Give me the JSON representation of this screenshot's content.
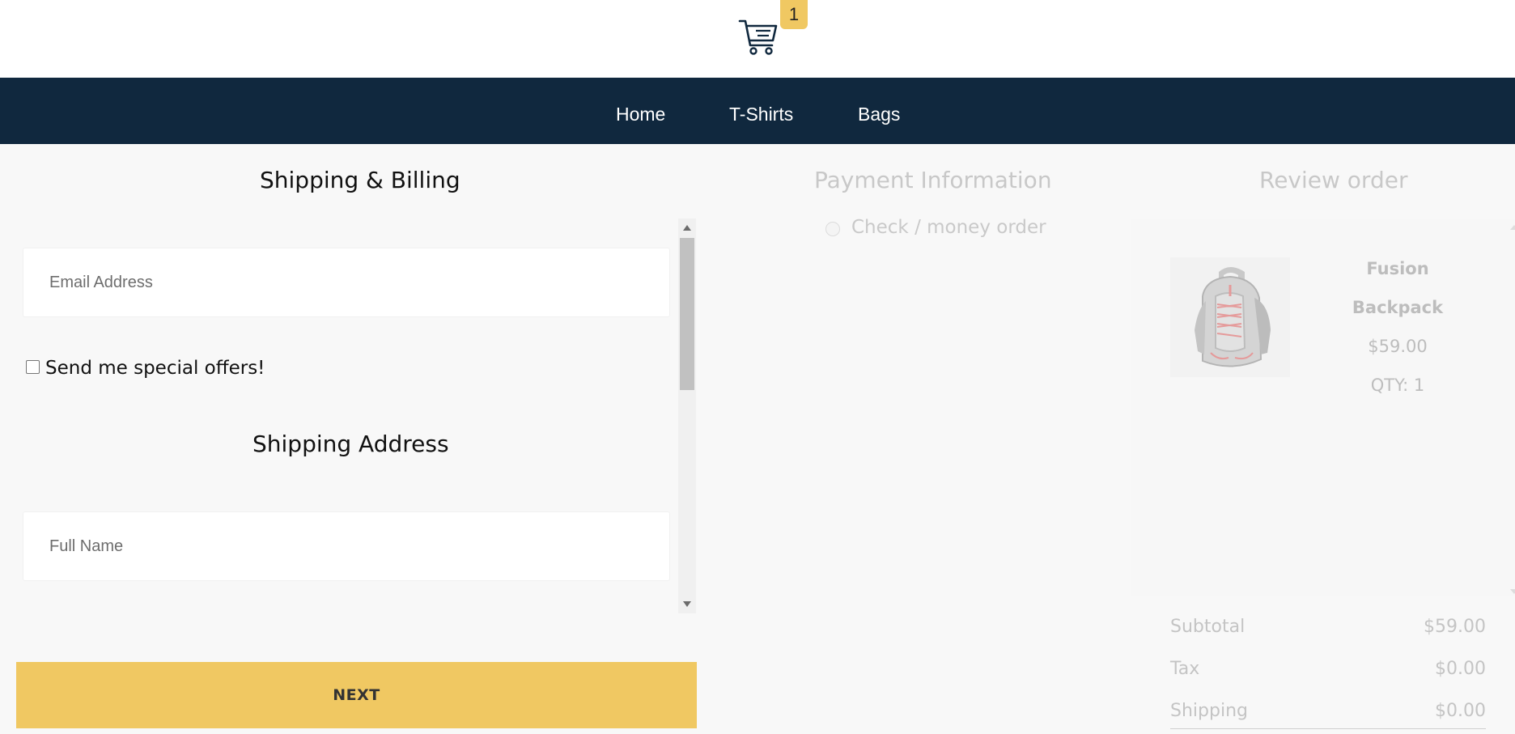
{
  "header": {
    "cart_icon": "shopping-cart-icon",
    "cart_count": "1",
    "badge_color": "#f0c862"
  },
  "nav": {
    "background": "#10283e",
    "items": [
      {
        "label": "Home"
      },
      {
        "label": "T-Shirts"
      },
      {
        "label": "Bags"
      }
    ]
  },
  "steps": {
    "shipping_title": "Shipping & Billing",
    "payment_title": "Payment Information",
    "review_title": "Review order"
  },
  "shipping_form": {
    "email_placeholder": "Email Address",
    "offers_label": "Send me special offers!",
    "address_title": "Shipping Address",
    "full_name_placeholder": "Full Name",
    "next_label": "NEXT"
  },
  "payment": {
    "method_label": "Check / money order"
  },
  "review": {
    "product": {
      "name_line1": "Fusion",
      "name_line2": "Backpack",
      "price": "$59.00",
      "qty": "QTY: 1",
      "image_icon": "backpack-icon"
    },
    "totals": [
      {
        "label": "Subtotal",
        "value": "$59.00"
      },
      {
        "label": "Tax",
        "value": "$0.00"
      },
      {
        "label": "Shipping",
        "value": "$0.00"
      }
    ]
  }
}
